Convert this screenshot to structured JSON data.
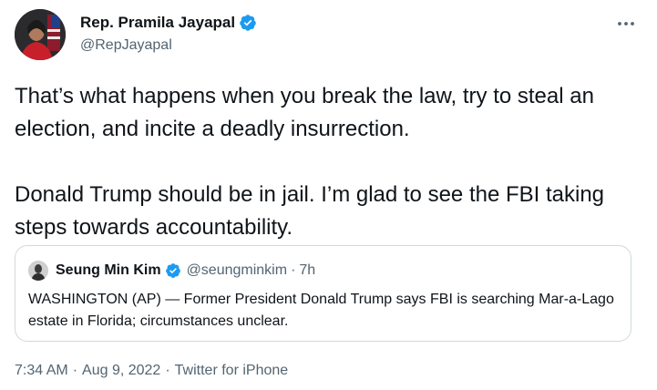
{
  "author": {
    "name": "Rep. Pramila Jayapal",
    "handle": "@RepJayapal",
    "verified_color": "#1d9bf0"
  },
  "tweet": {
    "paragraphs": [
      "That’s what happens when you break the law, try to steal an election, and incite a deadly insurrection.",
      "Donald Trump should be in jail. I’m glad to see the FBI taking steps towards accountability."
    ]
  },
  "quoted": {
    "name": "Seung Min Kim",
    "handle": "@seungminkim",
    "separator": "·",
    "time": "7h",
    "text": "WASHINGTON (AP) — Former President Donald Trump says FBI is searching Mar-a-Lago estate in Florida; circumstances unclear."
  },
  "meta": {
    "time": "7:34 AM",
    "dot": "·",
    "date": "Aug 9, 2022",
    "source": "Twitter for iPhone"
  },
  "icons": {
    "more": "more-horizontal-icon",
    "verified": "verified-badge-icon"
  }
}
